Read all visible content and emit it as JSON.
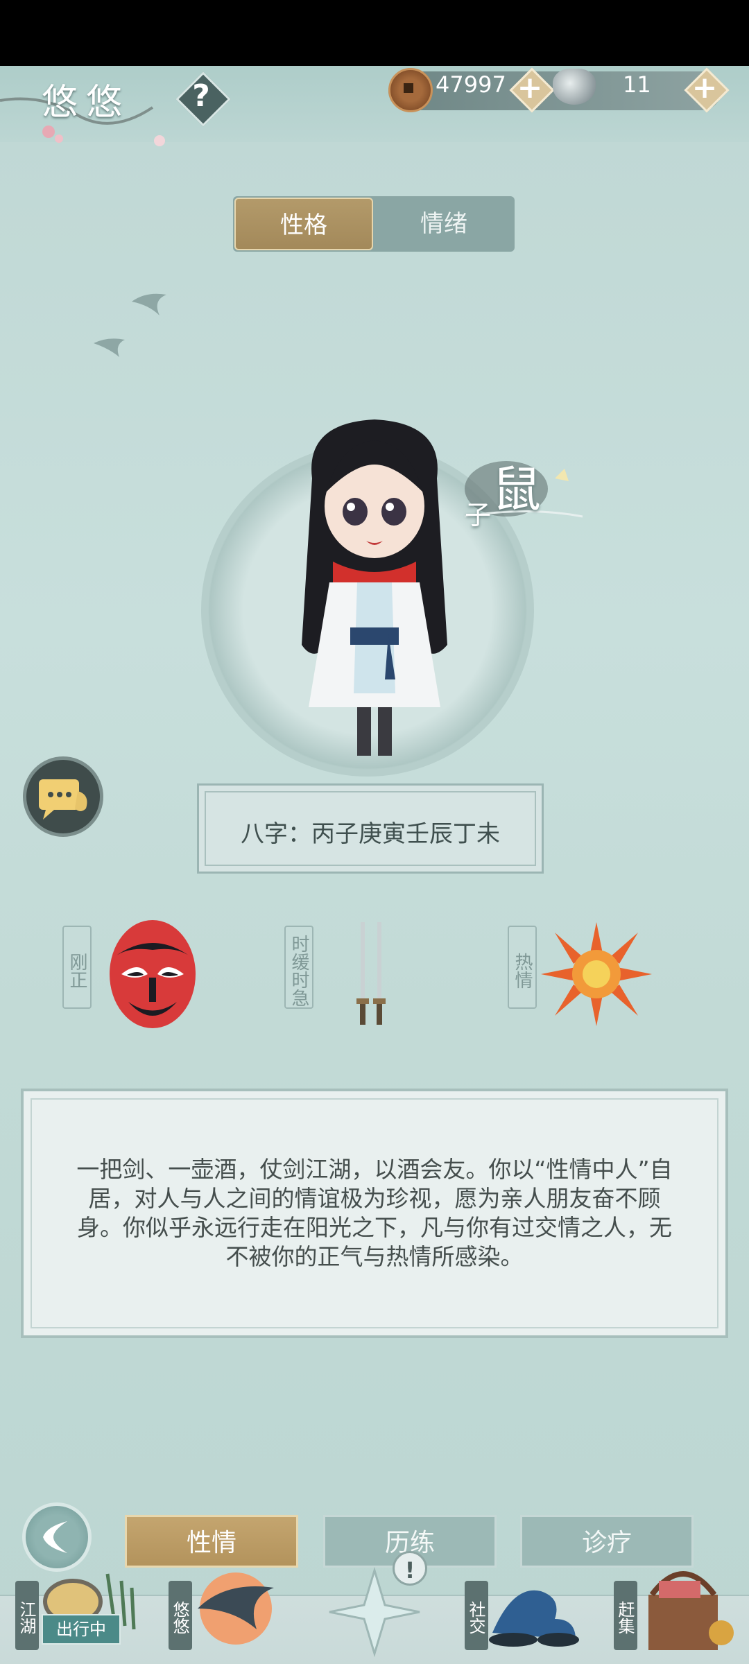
{
  "header": {
    "player_name": "悠悠",
    "help_label": "?",
    "copper_coins": "47997",
    "silver": "11",
    "plus_label": "+"
  },
  "toggle": {
    "active": "性格",
    "inactive": "情绪"
  },
  "zodiac": {
    "animal": "鼠",
    "branch": "子"
  },
  "bazi": {
    "text": "八字：丙子庚寅壬辰丁未"
  },
  "traits": [
    {
      "label": "刚正",
      "icon": "opera-mask-icon"
    },
    {
      "label": "时缓时急",
      "icon": "twin-swords-icon"
    },
    {
      "label": "热情",
      "icon": "sun-emblem-icon"
    }
  ],
  "description": "一把剑、一壶酒，仗剑江湖，以酒会友。你以“性情中人”自居，对人与人之间的情谊极为珍视，愿为亲人朋友奋不顾身。你似乎永远行走在阳光之下，凡与你有过交情之人，无不被你的正气与热情所感染。",
  "tabs": {
    "active": "性情",
    "second": "历练",
    "third": "诊疗"
  },
  "nav": {
    "jianghu": "江湖",
    "outing_status": "出行中",
    "youyou": "悠悠",
    "center_alert": "!",
    "social": "社交",
    "market": "赶集"
  },
  "colors": {
    "accent_gold": "#b3935c",
    "teal_bg": "#c8dfdc"
  }
}
